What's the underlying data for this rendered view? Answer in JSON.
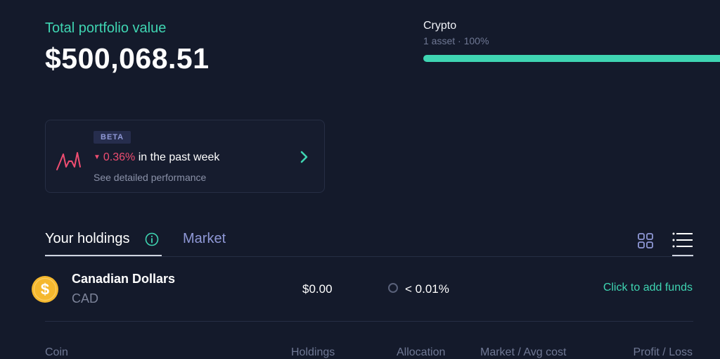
{
  "portfolio": {
    "total_label": "Total portfolio value",
    "total_value": "$500,068.51"
  },
  "allocation": {
    "name": "Crypto",
    "summary": "1 asset · 100%",
    "percent": 100,
    "bar_color": "#3fd5b2"
  },
  "performance": {
    "badge": "BETA",
    "direction_icon": "down-triangle-icon",
    "change": "0.36%",
    "period_text": "in the past week",
    "link_text": "See detailed performance",
    "negative_color": "#ef4d71"
  },
  "tabs": {
    "holdings": "Your holdings",
    "market": "Market"
  },
  "holdings": [
    {
      "name": "Canadian Dollars",
      "ticker": "CAD",
      "icon": "dollar-coin-icon",
      "value": "$0.00",
      "allocation": "< 0.01%",
      "action": "Click to add funds"
    }
  ],
  "columns": {
    "coin": "Coin",
    "holdings": "Holdings",
    "allocation": "Allocation",
    "market": "Market / Avg cost",
    "profit": "Profit / Loss"
  },
  "colors": {
    "background": "#141a2b",
    "accent": "#3fd5b2",
    "muted": "#6f7894"
  }
}
